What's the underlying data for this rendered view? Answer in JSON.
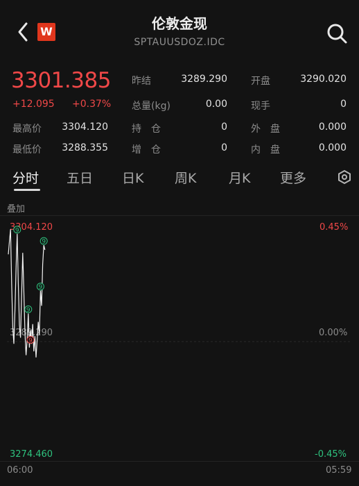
{
  "header": {
    "title": "伦敦金现",
    "code": "SPTAUUSDOZ.IDC",
    "logo_text": "W",
    "icons": {
      "back": "back-chevron-icon",
      "search": "search-icon",
      "logo": "app-logo-icon"
    }
  },
  "quote": {
    "price": "3301.385",
    "change": "+12.095",
    "change_pct": "+0.37%",
    "fields": {
      "prev_close_label": "昨结",
      "prev_close": "3289.290",
      "open_label": "开盘",
      "open": "3290.020",
      "volume_label": "总量(kg)",
      "volume": "0.00",
      "current_hand_label": "现手",
      "current_hand": "0",
      "high_label": "最高价",
      "high": "3304.120",
      "position_label": "持　仓",
      "position": "0",
      "outer_label": "外　盘",
      "outer": "0.000",
      "low_label": "最低价",
      "low": "3288.355",
      "increase_label": "增　仓",
      "increase": "0",
      "inner_label": "内　盘",
      "inner": "0.000"
    }
  },
  "tabs": [
    "分时",
    "五日",
    "日K",
    "周K",
    "月K",
    "更多"
  ],
  "active_tab": 0,
  "overlay_label": "叠加",
  "colors": {
    "up": "#f04848",
    "down": "#2ec27e",
    "background": "#131313"
  },
  "chart_data": {
    "type": "line",
    "y_left_ticks": [
      "3304.120",
      "3289.290",
      "3274.460"
    ],
    "y_right_ticks": [
      "0.45%",
      "0.00%",
      "-0.45%"
    ],
    "x_ticks": [
      "06:00",
      "05:59"
    ],
    "ylim": [
      3274.46,
      3304.12
    ],
    "markers": [
      "9",
      "9",
      "9",
      "9",
      "9"
    ],
    "series": [
      {
        "values": [
          3300.8,
          3302.5,
          3304.1,
          3297.0,
          3291.2,
          3289.0,
          3293.5,
          3299.0,
          3303.5,
          3297.0,
          3291.5,
          3289.8,
          3295.5,
          3301.0,
          3296.0,
          3290.5,
          3287.5,
          3289.6,
          3293.0,
          3288.5,
          3290.8,
          3289.0,
          3291.6,
          3288.0,
          3290.0,
          3287.2,
          3289.5,
          3291.9,
          3290.2,
          3296.0,
          3294.0,
          3299.5,
          3302.0,
          3301.385
        ]
      }
    ]
  }
}
